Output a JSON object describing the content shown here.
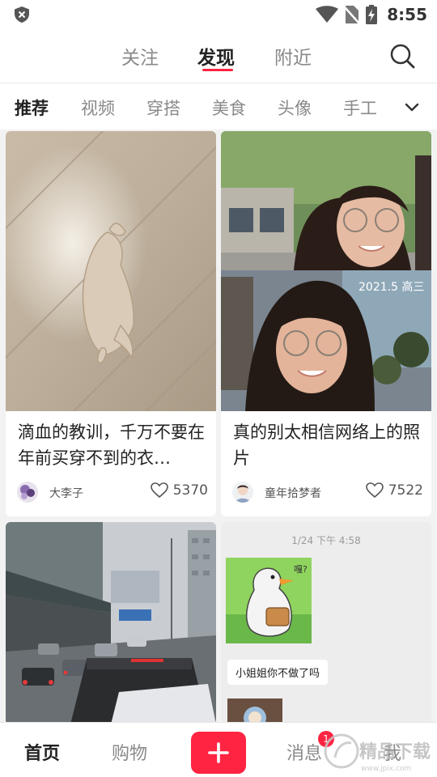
{
  "status_bar": {
    "time": "8:55"
  },
  "top_nav": {
    "tabs": [
      {
        "label": "关注"
      },
      {
        "label": "发现"
      },
      {
        "label": "附近"
      }
    ]
  },
  "categories": [
    "推荐",
    "视频",
    "穿搭",
    "美食",
    "头像",
    "手工"
  ],
  "feed": [
    {
      "title": "滴血的教训，千万不要在年前买穿不到的衣…",
      "author": "大李子",
      "likes": "5370"
    },
    {
      "title": "真的别太相信网络上的照片",
      "author": "童年拾梦者",
      "likes": "7522",
      "image_caption": "2021.5 高三"
    },
    {
      "title": "",
      "author": "",
      "likes": ""
    },
    {
      "title": "",
      "author": "",
      "likes": "",
      "chat_timestamp": "1/24 下午 4:58",
      "chat_bubble_sticker_text": "嘎?",
      "chat_message": "小姐姐你不做了吗"
    }
  ],
  "bottom_nav": {
    "home": "首页",
    "shop": "购物",
    "messages": "消息",
    "messages_badge": "1",
    "me": "我"
  },
  "watermark": {
    "text": "精品下载",
    "sub": "www.jpix.com"
  },
  "colors": {
    "accent": "#ff2442",
    "text_primary": "#222222",
    "text_secondary": "#8a8a8a"
  }
}
